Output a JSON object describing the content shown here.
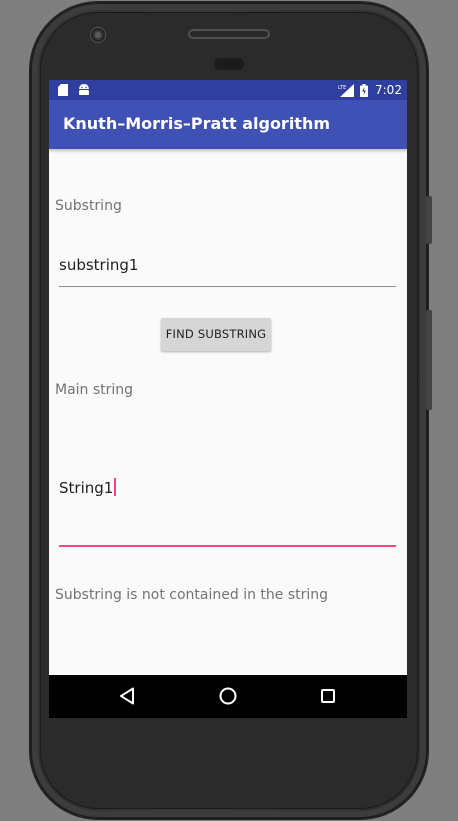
{
  "status_bar": {
    "time": "7:02",
    "icons": [
      "sd-card-icon",
      "android-icon",
      "signal-lte-icon",
      "battery-icon"
    ]
  },
  "app_bar": {
    "title": "Knuth–Morris–Pratt algorithm"
  },
  "form": {
    "substring_label": "Substring",
    "substring_value": "substring1",
    "find_button_label": "FIND SUBSTRING",
    "main_string_label": "Main string",
    "main_string_value": "String1",
    "result_text": "Substring is not contained in the string"
  },
  "nav_bar": {
    "icons": [
      "back-icon",
      "home-icon",
      "recents-icon"
    ]
  },
  "colors": {
    "status_bar": "#303f9f",
    "app_bar": "#3f51b5",
    "accent": "#ff4081",
    "background": "#fafafa",
    "button": "#d6d6d6",
    "device_bg": "#7f7f7f"
  }
}
